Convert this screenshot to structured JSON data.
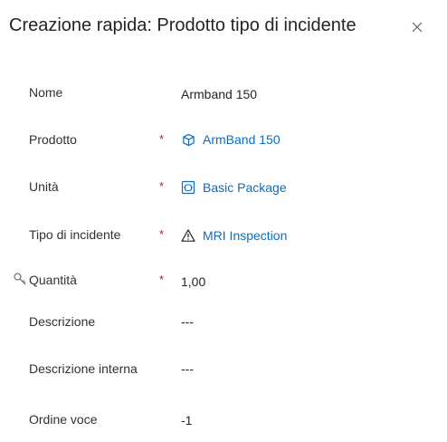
{
  "header": {
    "title": "Creazione rapida: Prodotto tipo di incidente",
    "close_icon": "close-icon"
  },
  "form": {
    "fields": [
      {
        "label": "Nome",
        "value": "Armband 150",
        "required": false,
        "link": false
      },
      {
        "label": "Prodotto",
        "value": "ArmBand 150",
        "required": true,
        "link": true,
        "icon": "product-cube-icon"
      },
      {
        "label": "Unità",
        "value": "Basic Package",
        "required": true,
        "link": true,
        "icon": "unit-package-icon"
      },
      {
        "label": "Tipo di incidente",
        "value": "MRI Inspection",
        "required": true,
        "link": true,
        "icon": "warning-triangle-icon"
      },
      {
        "label": "Quantità",
        "value": "1,00",
        "required": true,
        "link": false,
        "locked": true
      },
      {
        "label": "Descrizione",
        "value": "---",
        "required": false,
        "link": false
      },
      {
        "label": "Descrizione interna",
        "value": "---",
        "required": false,
        "link": false
      },
      {
        "label": "Ordine voce",
        "value": "-1",
        "required": false,
        "link": false
      }
    ],
    "required_marker": "*"
  },
  "colors": {
    "link": "#0f6cbd",
    "required": "#a4262c",
    "text": "#242424"
  }
}
